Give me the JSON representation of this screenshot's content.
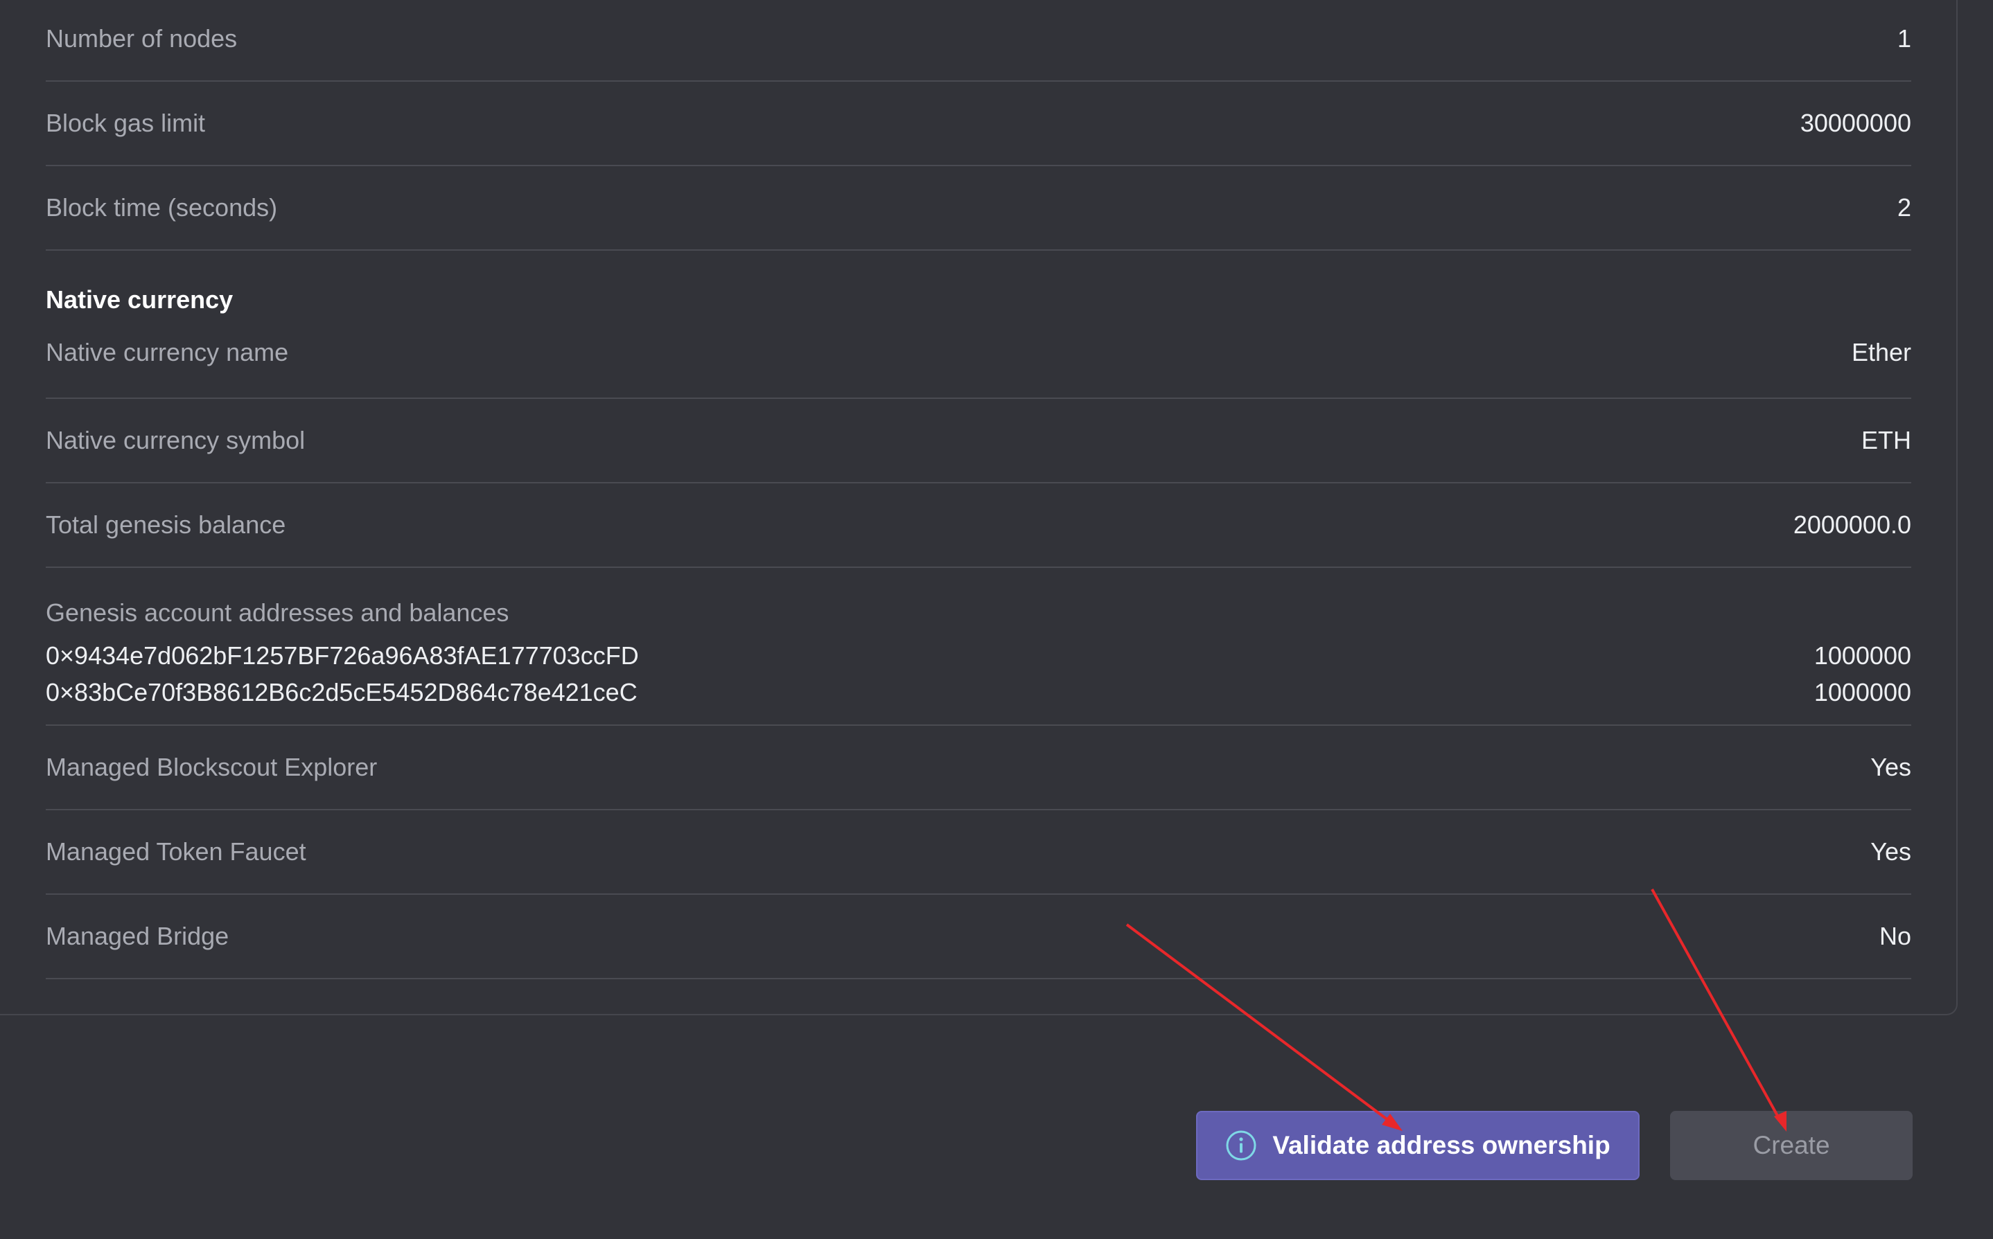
{
  "rows_top": [
    {
      "label": "Number of nodes",
      "value": "1"
    },
    {
      "label": "Block gas limit",
      "value": "30000000"
    },
    {
      "label": "Block time (seconds)",
      "value": "2"
    }
  ],
  "native_currency": {
    "title": "Native currency",
    "rows": [
      {
        "label": "Native currency name",
        "value": "Ether"
      },
      {
        "label": "Native currency symbol",
        "value": "ETH"
      },
      {
        "label": "Total genesis balance",
        "value": "2000000.0"
      }
    ]
  },
  "genesis": {
    "label": "Genesis account addresses and balances",
    "accounts": [
      {
        "address": "0×9434e7d062bF1257BF726a96A83fAE177703ccFD",
        "balance": "1000000"
      },
      {
        "address": "0×83bCe70f3B8612B6c2d5cE5452D864c78e421ceC",
        "balance": "1000000"
      }
    ]
  },
  "rows_bottom": [
    {
      "label": "Managed Blockscout Explorer",
      "value": "Yes"
    },
    {
      "label": "Managed Token Faucet",
      "value": "Yes"
    },
    {
      "label": "Managed Bridge",
      "value": "No"
    }
  ],
  "actions": {
    "validate_label": "Validate address ownership",
    "validate_icon": "info-icon",
    "create_label": "Create"
  },
  "colors": {
    "background": "#323339",
    "primary_button": "#5f5cad",
    "disabled_button": "#4a4b54",
    "annotation_arrow": "#e8272a"
  }
}
